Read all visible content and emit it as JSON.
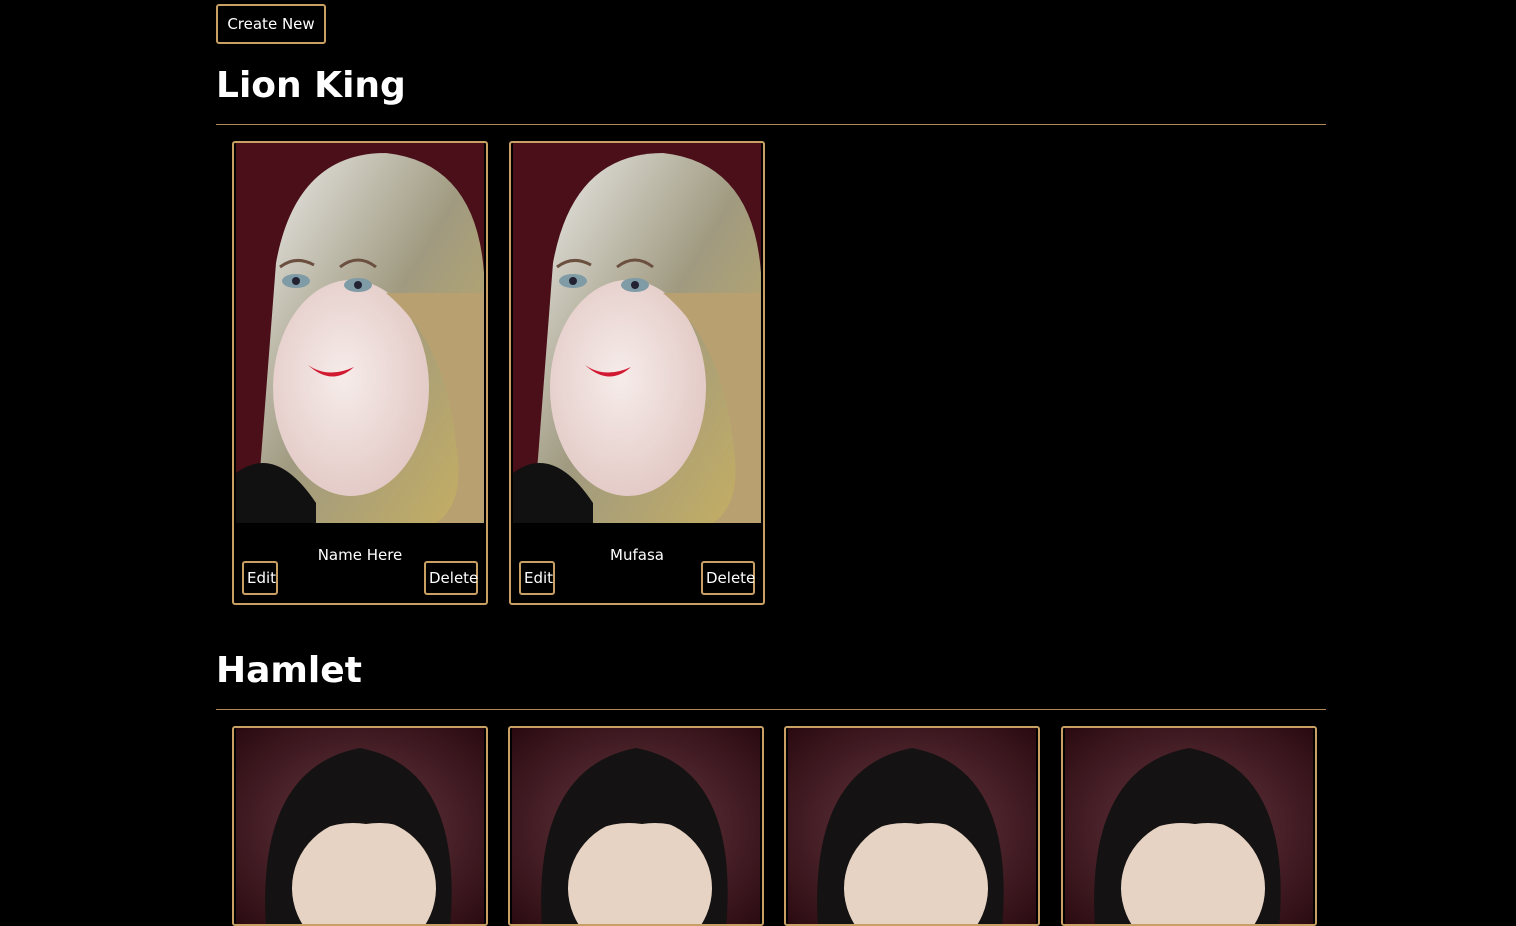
{
  "toolbar": {
    "create_label": "Create New"
  },
  "sections": [
    {
      "title": "Lion King",
      "cards": [
        {
          "name": "Name Here",
          "edit_label": "Edit",
          "delete_label": "Delete"
        },
        {
          "name": "Mufasa",
          "edit_label": "Edit",
          "delete_label": "Delete"
        }
      ]
    },
    {
      "title": "Hamlet",
      "cards": [
        {},
        {},
        {},
        {}
      ]
    }
  ],
  "colors": {
    "background": "#000000",
    "accent_border": "#c9a063",
    "text": "#ffffff"
  }
}
